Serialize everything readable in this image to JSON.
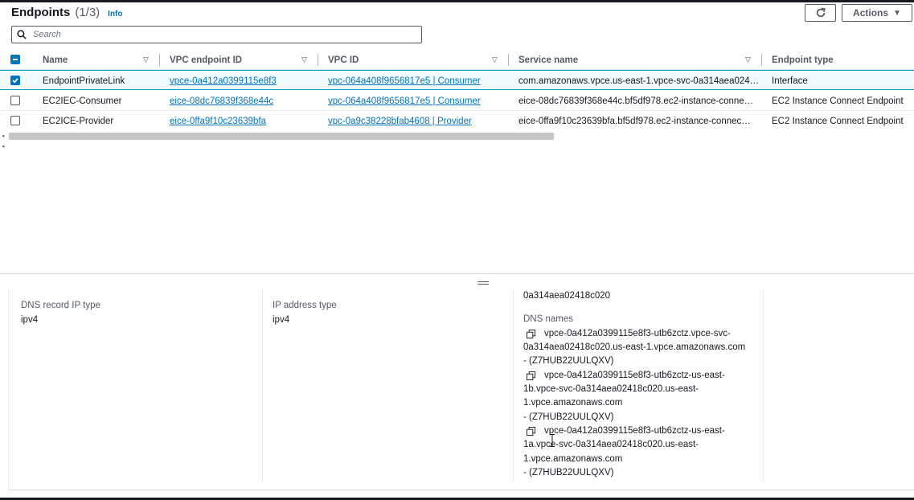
{
  "header": {
    "title": "Endpoints",
    "count": "(1/3)",
    "info": "Info",
    "actions_label": "Actions"
  },
  "search": {
    "placeholder": "Search"
  },
  "table": {
    "columns": [
      "Name",
      "VPC endpoint ID",
      "VPC ID",
      "Service name",
      "Endpoint type"
    ],
    "rows": [
      {
        "name": "EndpointPrivateLink",
        "endpoint_id": "vpce-0a412a0399115e8f3",
        "vpc_id": "vpc-064a408f9656817e5 | Consumer",
        "service_name": "com.amazonaws.vpce.us-east-1.vpce-svc-0a314aea024…",
        "endpoint_type": "Interface",
        "selected": true
      },
      {
        "name": "EC2IEC-Consumer",
        "endpoint_id": "eice-08dc76839f368e44c",
        "vpc_id": "vpc-064a408f9656817e5 | Consumer",
        "service_name": "eice-08dc76839f368e44c.bf5df978.ec2-instance-conne…",
        "endpoint_type": "EC2 Instance Connect Endpoint",
        "selected": false
      },
      {
        "name": "EC2ICE-Provider",
        "endpoint_id": "eice-0ffa9f10c23639bfa",
        "vpc_id": "vpc-0a9c38228bfab4608 | Provider",
        "service_name": "eice-0ffa9f10c23639bfa.bf5df978.ec2-instance-connec…",
        "endpoint_type": "EC2 Instance Connect Endpoint",
        "selected": false
      }
    ]
  },
  "details": {
    "dns_record_ip_type_label": "DNS record IP type",
    "dns_record_ip_type_value": "ipv4",
    "ip_address_type_label": "IP address type",
    "ip_address_type_value": "ipv4",
    "service_name_tail": "0a314aea02418c020",
    "dns_names_label": "DNS names",
    "dns_names": [
      {
        "line1": "vpce-0a412a0399115e8f3-utb6zctz.vpce-svc-",
        "line2": "0a314aea02418c020.us-east-1.vpce.amazonaws.com",
        "line3": "- (Z7HUB22UULQXV)"
      },
      {
        "line1": "vpce-0a412a0399115e8f3-utb6zctz-us-east-",
        "line2": "1b.vpce-svc-0a314aea02418c020.us-east-",
        "line3": "1.vpce.amazonaws.com",
        "line4": "- (Z7HUB22UULQXV)"
      },
      {
        "line1": "vpce-0a412a0399115e8f3-utb6zctz-us-east-",
        "line2": "1a.vpce-svc-0a314aea02418c020.us-east-",
        "line3": "1.vpce.amazonaws.com",
        "line4": "- (Z7HUB22UULQXV)"
      }
    ]
  },
  "colors": {
    "link": "#0073bb",
    "selected_row_bg": "#f1faff",
    "selected_border": "#00a1c9",
    "text": "#16191f",
    "muted": "#545b64"
  },
  "icons": {
    "refresh": "refresh-icon",
    "search": "search-icon",
    "filter": "sort-caret-icon",
    "copy": "copy-icon"
  }
}
